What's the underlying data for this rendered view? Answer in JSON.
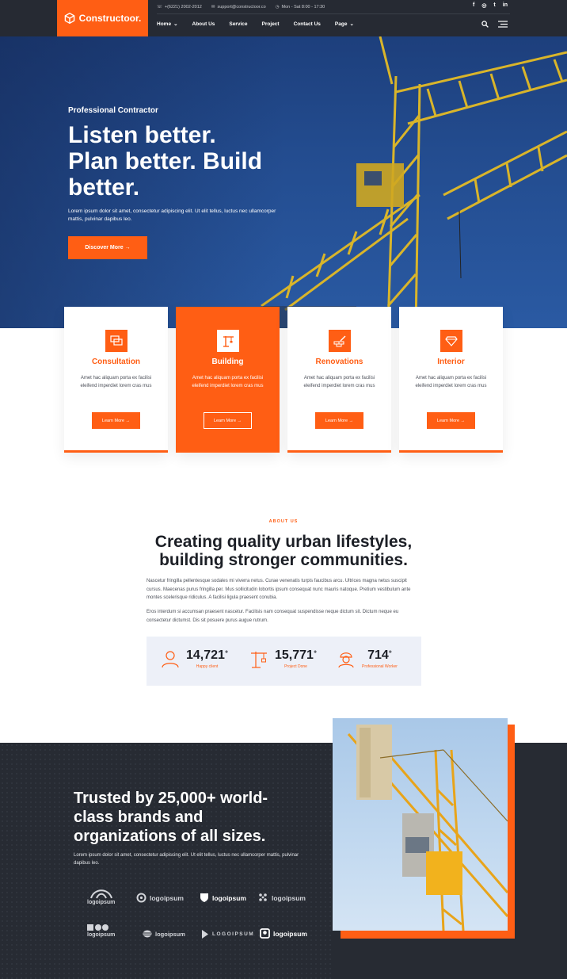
{
  "header": {
    "brand": "Constructoor.",
    "phone": "+(6221) 2002-2012",
    "email": "support@constructoor.co",
    "hours": "Mon - Sat 8:00 - 17:30",
    "socials": [
      "f",
      "◎",
      "t",
      "in"
    ],
    "nav": [
      {
        "label": "Home",
        "dropdown": true
      },
      {
        "label": "About Us",
        "dropdown": false
      },
      {
        "label": "Service",
        "dropdown": false
      },
      {
        "label": "Project",
        "dropdown": false
      },
      {
        "label": "Contact Us",
        "dropdown": false
      },
      {
        "label": "Page",
        "dropdown": true
      }
    ]
  },
  "hero": {
    "kicker": "Professional Contractor",
    "title_lines": [
      "Listen better.",
      "Plan better. Build",
      "better."
    ],
    "description": "Lorem ipsum dolor sit amet, consectetur adipiscing elit. Ut elit tellus, luctus nec ullamcorper mattis, pulvinar dapibus leo.",
    "button": "Discover More →"
  },
  "services": [
    {
      "title": "Consultation",
      "description": "Amet hac aliquam porta ex facilisi eleifend imperdiet lorem cras mus",
      "button": "Learn More →",
      "icon": "chat-icon"
    },
    {
      "title": "Building",
      "description": "Amet hac aliquam porta ex facilisi eleifend imperdiet lorem cras mus",
      "button": "Learn More →",
      "icon": "crane-icon"
    },
    {
      "title": "Renovations",
      "description": "Amet hac aliquam porta ex facilisi eleifend imperdiet lorem cras mus",
      "button": "Learn More →",
      "icon": "brick-icon"
    },
    {
      "title": "Interior",
      "description": "Amet hac aliquam porta ex facilisi eleifend imperdiet lorem cras mus",
      "button": "Learn More →",
      "icon": "diamond-icon"
    }
  ],
  "about": {
    "kicker": "ABOUT US",
    "title_lines": [
      "Creating quality urban lifestyles,",
      "building stronger communities."
    ],
    "paragraph1": "Nascetur fringilla pellentesque sodales mi viverra netus. Curae venenatis turpis faucibus arcu. Ultrices magna netus suscipit cursus. Maecenas purus fringilla per. Mus sollicitudin lobortis ipsum consequat nunc mauris natoque. Pretium vestibulum ante montes scelerisque ridiculus. A facilisi ligula praesent conubia.",
    "paragraph2": "Eros interdum si accumsan praesent nascetur. Facilisis nam consequat suspendisse neque dictum sit. Dictum neque eu consectetur dictumst. Dis sit posuere purus augue rutrum.",
    "stats": [
      {
        "value": "14,721",
        "suffix": "+",
        "label": "Happy client",
        "icon": "user-icon"
      },
      {
        "value": "15,771",
        "suffix": "+",
        "label": "Project Done",
        "icon": "crane-icon"
      },
      {
        "value": "714",
        "suffix": "+",
        "label": "Professional Worker",
        "icon": "worker-icon"
      }
    ]
  },
  "trusted": {
    "title_lines": [
      "Trusted by 25,000+ world-",
      "class brands and",
      "organizations of all sizes."
    ],
    "description": "Lorem ipsum dolor sit amet, consectetur adipiscing elit. Ut elit tellus, luctus nec ullamcorper mattis, pulvinar dapibus leo.",
    "logos": [
      "logoipsum",
      "logoipsum",
      "logoipsum",
      "logoipsum",
      "logoipsum",
      "logoipsum",
      "LOGOIPSUM",
      "logoipsum"
    ]
  },
  "colors": {
    "accent": "#ff5e14",
    "dark": "#272b33",
    "hero_sky": "#234c8f"
  }
}
